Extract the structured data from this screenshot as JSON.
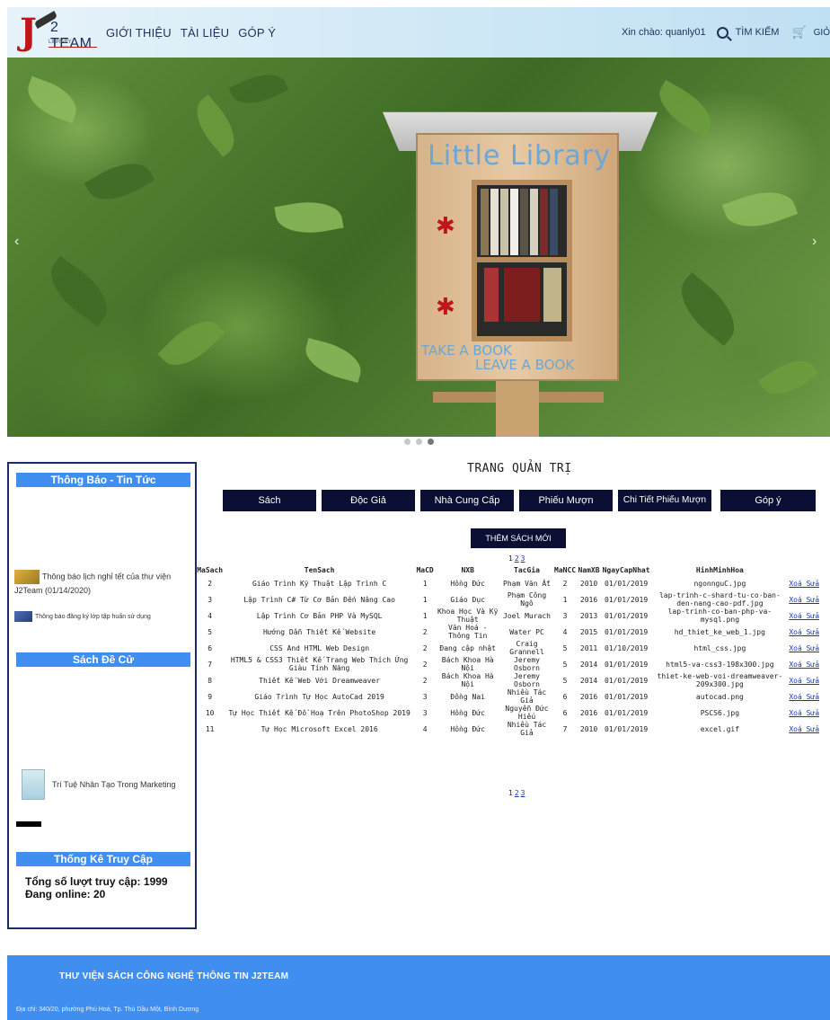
{
  "header": {
    "logo_text": "2 TEAM",
    "logo_sub": "LIBRARY",
    "nav": [
      "GIỚI THIỆU",
      "TÀI LIỆU",
      "GÓP Ý"
    ],
    "greeting": "Xin chào: quanly01",
    "search_label": "TÌM KIẾM",
    "cart_label": "GIỎ"
  },
  "banner": {
    "sign_title": "Little Library",
    "sign_line1": "TAKE A BOOK",
    "sign_line2": "LEAVE A BOOK",
    "prev_arrow": "‹",
    "next_arrow": "›",
    "slide_count": 3,
    "active_slide": 3
  },
  "sidebar": {
    "news_title": "Thông Báo - Tin Tức",
    "news_items": [
      {
        "text": "Thông báo lịch nghỉ tết của thư viện J2Team (01/14/2020)"
      },
      {
        "text": "Thông báo đăng ký lớp tập huấn sử dụng"
      }
    ],
    "recommended_title": "Sách Đề Cử",
    "recommended_book": "Trí Tuệ Nhân Tạo Trong Marketing",
    "stats_title": "Thống Kê Truy Cập",
    "stats_total": "Tổng số lượt truy cập: 1999",
    "stats_online": "Đang online: 20"
  },
  "admin": {
    "title": "TRANG QUẢN TRỊ",
    "tabs": [
      "Sách",
      "Độc Giả",
      "Nhà Cung Cấp",
      "Phiếu Mượn",
      "Chi Tiết Phiếu Mượn",
      "Góp ý"
    ],
    "add_button": "THÊM SÁCH MỚI",
    "pages": [
      "1",
      "2",
      "3"
    ],
    "columns": [
      "MaSach",
      "TenSach",
      "MaCD",
      "NXB",
      "TacGia",
      "MaNCC",
      "NamXB",
      "NgayCapNhat",
      "HinhMinhHoa"
    ],
    "action_label": "Xoá Sửa",
    "rows": [
      [
        "2",
        "Giáo Trình Kỹ Thuật Lập Trình C",
        "1",
        "Hồng Đức",
        "Phạm Văn Ất",
        "2",
        "2010",
        "01/01/2019",
        "ngonnguC.jpg"
      ],
      [
        "3",
        "Lập Trình C# Từ Cơ Bản Đến Nâng Cao",
        "1",
        "Giáo Dục",
        "Phạm Công Ngô",
        "1",
        "2016",
        "01/01/2019",
        "lap-trinh-c-shard-tu-co-ban-den-nang-cao-pdf.jpg"
      ],
      [
        "4",
        "Lập Trình Cơ Bản PHP Và MySQL",
        "1",
        "Khoa Học Và Kỹ Thuật",
        "Joel Murach",
        "3",
        "2013",
        "01/01/2019",
        "lap-trinh-co-ban-php-va-mysql.png"
      ],
      [
        "5",
        "Hướng Dẫn Thiết Kế Website",
        "2",
        "Văn Hoá - Thông Tin",
        "Water PC",
        "4",
        "2015",
        "01/01/2019",
        "hd_thiet_ke_web_1.jpg"
      ],
      [
        "6",
        "CSS And HTML Web Design",
        "2",
        "Đang cập nhật",
        "Craig Grannell",
        "5",
        "2011",
        "01/10/2019",
        "html_css.jpg"
      ],
      [
        "7",
        "HTML5 & CSS3 Thiết Kế Trang Web Thích Ứng Giàu Tính Năng",
        "2",
        "Bách Khoa Hà Nội",
        "Jeremy Osborn",
        "5",
        "2014",
        "01/01/2019",
        "html5-va-css3-198x300.jpg"
      ],
      [
        "8",
        "Thiết Kế Web Với Dreamweaver",
        "2",
        "Bách Khoa Hà Nội",
        "Jeremy Osborn",
        "5",
        "2014",
        "01/01/2019",
        "thiet-ke-web-voi-dreamweaver-209x300.jpg"
      ],
      [
        "9",
        "Giáo Trình Tự Học AutoCad 2019",
        "3",
        "Đồng Nai",
        "Nhiều Tác Giả",
        "6",
        "2016",
        "01/01/2019",
        "autocad.png"
      ],
      [
        "10",
        "Tự Học Thiết Kế Đồ Hoạ Trên PhotoShop 2019",
        "3",
        "Hồng Đức",
        "Nguyễn Đức Hiếu",
        "6",
        "2016",
        "01/01/2019",
        "PSCS6.jpg"
      ],
      [
        "11",
        "Tự Học Microsoft Excel 2016",
        "4",
        "Hồng Đức",
        "Nhiều Tác Giả",
        "7",
        "2010",
        "01/01/2019",
        "excel.gif"
      ]
    ]
  },
  "footer": {
    "title": "THƯ VIỆN SÁCH CÔNG NGHỆ THÔNG TIN J2TEAM",
    "address": "Địa chỉ: 340/20, phường Phú Hoà, Tp. Thủ Dầu Một, Bình Dương"
  },
  "colors": {
    "accent_blue": "#3f8ef0",
    "dark_navy": "#0c0f34",
    "link_blue": "#1a36b7",
    "logo_red": "#c0151b"
  },
  "icons": [
    "search-icon",
    "cart-icon",
    "chevron-left-icon",
    "chevron-right-icon"
  ]
}
